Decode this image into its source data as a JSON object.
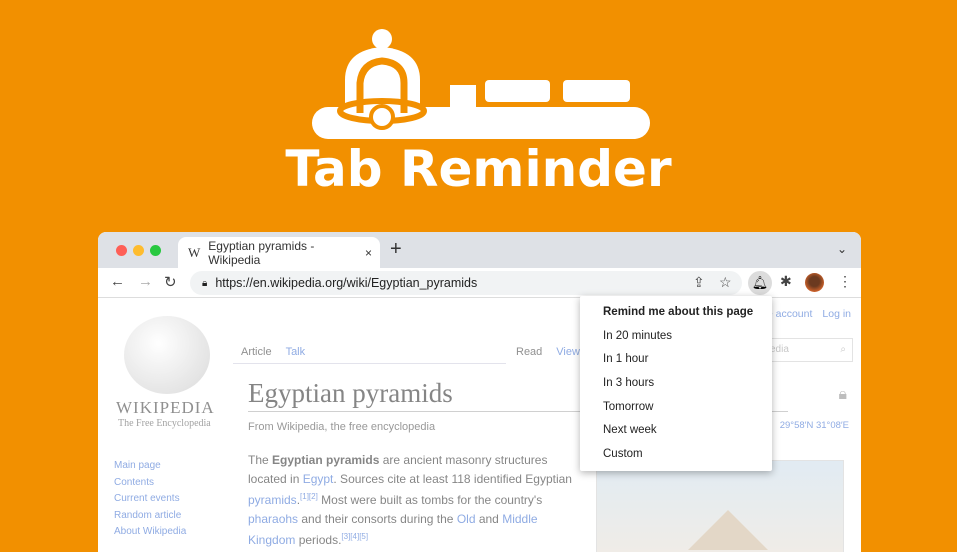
{
  "brand": {
    "title": "Tab Reminder",
    "background": "#F29000",
    "logo_icon": "bell-icon"
  },
  "browser": {
    "tab": {
      "favicon": "W",
      "title": "Egyptian pyramids - Wikipedia",
      "close": "×"
    },
    "new_tab": "+",
    "tab_menu": "⌄",
    "url": "https://en.wikipedia.org/wiki/Egyptian_pyramids"
  },
  "wiki": {
    "wordmark": "WIKIPEDIA",
    "tagline": "The Free Encyclopedia",
    "sidebar": [
      "Main page",
      "Contents",
      "Current events",
      "Random article",
      "About Wikipedia"
    ],
    "account": [
      "e account",
      "Log in"
    ],
    "search_placeholder": "edia",
    "tabs_left": [
      "Article",
      "Talk"
    ],
    "tabs_right": [
      "Read",
      "View"
    ],
    "heading": "Egyptian pyramids",
    "from": "From Wikipedia, the free encyclopedia",
    "coords": "29°58′N 31°08′E",
    "para": {
      "t1": "The ",
      "b1": "Egyptian pyramids",
      "t2": " are ancient masonry structures located in ",
      "l1": "Egypt",
      "t3": ". Sources cite at least 118 identified Egyptian ",
      "l2": "pyramids",
      "t4": ".",
      "s1": "[1][2]",
      "t5": " Most were built as tombs for the country's ",
      "l3": "pharaohs",
      "t6": " and their consorts during the ",
      "l4": "Old",
      "t7": " and ",
      "l5": "Middle Kingdom",
      "t8": " periods.",
      "s2": "[3][4][5]"
    }
  },
  "menu": {
    "header": "Remind me about this page",
    "items": [
      "In 20 minutes",
      "In 1 hour",
      "In 3 hours",
      "Tomorrow",
      "Next week",
      "Custom"
    ]
  }
}
